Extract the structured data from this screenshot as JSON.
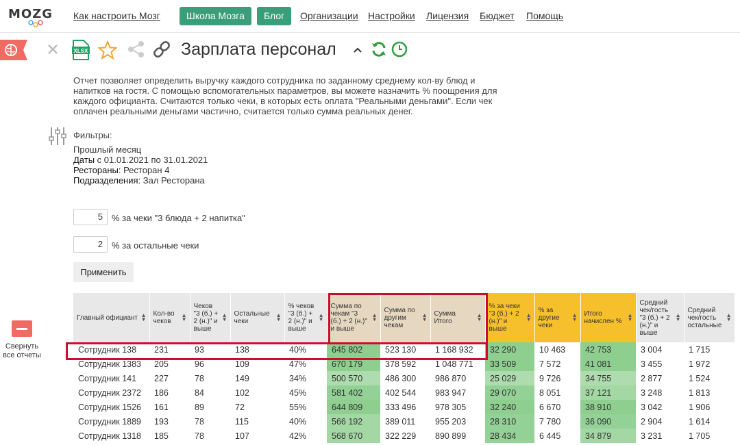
{
  "nav": {
    "logo": "MOZG",
    "links": [
      "Как настроить Мозг",
      "Организации",
      "Настройки",
      "Лицензия",
      "Бюджет",
      "Помощь"
    ],
    "btn_school": "Школа Мозга",
    "btn_blog": "Блог"
  },
  "report": {
    "title": "Зарплата персонал",
    "xlsx": "XLSX",
    "description": "Отчет позволяет определить выручку каждого сотрудника по заданному среднему кол-ву блюд и напитков на гостя. С помощью вспомогательных параметров, вы можете назначить % поощрения для каждого официанта. Считаются только чеки, в которых есть оплата \"Реальными деньгами\". Если чек оплачен реальными деньгами частично, считается только сумма реальных денег."
  },
  "filters": {
    "title": "Фильтры:",
    "period": "Прошлый месяц",
    "dates_label": "Даты",
    "dates_value": " с 01.01.2021 по 31.01.2021",
    "restaurants_label": "Рестораны:",
    "restaurants_value": " Ресторан 4",
    "divisions_label": "Подразделения:",
    "divisions_value": " Зал Ресторана"
  },
  "params": {
    "p1_value": "5",
    "p1_label": "% за чеки \"3 блюда + 2 напитка\"",
    "p2_value": "2",
    "p2_label": "% за остальные чеки",
    "apply": "Применить"
  },
  "sidebar": {
    "collapse_label": "Свернуть все отчеты"
  },
  "table": {
    "headers": [
      "Главный официант",
      "Кол-во чеков",
      "Чеков \"3 (б.) + 2 (н.)\" и выше",
      "Остальные чеки",
      "% чеков \"3 (б.) + 2 (н.)\" и выше",
      "Сумма по чекам \"3 (б.) + 2 (н.)\" и выше",
      "Сумма по другим чекам",
      "Сумма Итого",
      "% за чеки \"3 (б.) + 2 (н.)\" и выше",
      "% за другие чеки",
      "Итого начислен %",
      "Средний чек/гость \"3 (б.) + 2 (н.)\" и выше",
      "Средний чек/гость остальные"
    ],
    "rows": [
      [
        "Сотрудник 138",
        "231",
        "93",
        "138",
        "40%",
        "645 802",
        "523 130",
        "1 168 932",
        "32 290",
        "10 463",
        "42 753",
        "3 004",
        "1 715"
      ],
      [
        "Сотрудник 1383",
        "205",
        "96",
        "109",
        "47%",
        "670 179",
        "378 592",
        "1 048 771",
        "33 509",
        "7 572",
        "41 081",
        "3 455",
        "1 972"
      ],
      [
        "Сотрудник 141",
        "227",
        "78",
        "149",
        "34%",
        "500 570",
        "486 300",
        "986 870",
        "25 029",
        "9 726",
        "34 755",
        "2 877",
        "1 524"
      ],
      [
        "Сотрудник 2372",
        "186",
        "84",
        "102",
        "45%",
        "581 402",
        "402 544",
        "983 947",
        "29 070",
        "8 051",
        "37 121",
        "3 248",
        "1 813"
      ],
      [
        "Сотрудник 1526",
        "161",
        "89",
        "72",
        "55%",
        "644 809",
        "333 496",
        "978 305",
        "32 240",
        "6 670",
        "38 910",
        "3 042",
        "1 906"
      ],
      [
        "Сотрудник 1889",
        "193",
        "78",
        "115",
        "40%",
        "566 192",
        "389 011",
        "955 203",
        "28 310",
        "7 780",
        "36 090",
        "2 904",
        "1 614"
      ],
      [
        "Сотрудник 1318",
        "185",
        "78",
        "107",
        "42%",
        "568 670",
        "322 229",
        "890 899",
        "28 434",
        "6 445",
        "34 879",
        "3 231",
        "1 705"
      ]
    ]
  },
  "colors": {
    "accent": "#3a9e7a",
    "highlight": "#c8102e",
    "yellow": "#f6c02c"
  }
}
